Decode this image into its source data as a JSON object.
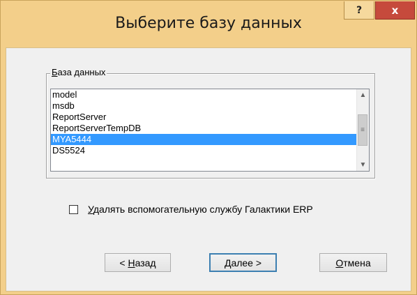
{
  "window": {
    "title": "Выберите базу данных",
    "help_glyph": "?",
    "close_glyph": "x"
  },
  "group": {
    "legend_mnemonic": "Б",
    "legend_rest": "аза данных"
  },
  "databases": {
    "items": [
      "model",
      "msdb",
      "ReportServer",
      "ReportServerTempDB",
      "MYA5444",
      "DS5524"
    ],
    "selected": "MYA5444"
  },
  "scrollbar": {
    "up_glyph": "▲",
    "down_glyph": "▼",
    "thumb_glyph": "≡"
  },
  "option": {
    "checked": false,
    "label_mnemonic": "У",
    "label_rest": "далять вспомогательную службу Галактики ERP"
  },
  "buttons": {
    "back_prefix": "< ",
    "back_mnemonic": "Н",
    "back_rest": "азад",
    "next_mnemonic": "Д",
    "next_rest": "алее >",
    "cancel_mnemonic": "О",
    "cancel_rest": "тмена"
  },
  "colors": {
    "titlebar": "#f3cf8a",
    "close_button": "#c64a3c",
    "selection": "#3399ff"
  }
}
